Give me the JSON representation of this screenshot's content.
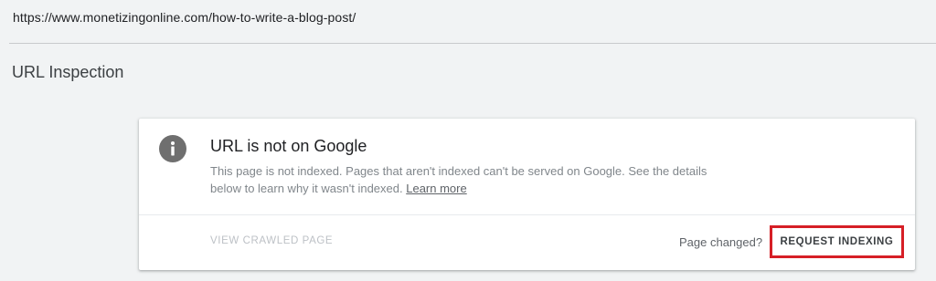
{
  "url_bar": {
    "url": "https://www.monetizingonline.com/how-to-write-a-blog-post/"
  },
  "section": {
    "title": "URL Inspection"
  },
  "card": {
    "icon": "info-icon",
    "title": "URL is not on Google",
    "description": "This page is not indexed. Pages that aren't indexed can't be served on Google. See the details below to learn why it wasn't indexed.",
    "learn_more": "Learn more",
    "view_crawled_label": "VIEW CRAWLED PAGE",
    "page_changed": "Page changed?",
    "request_indexing_label": "REQUEST INDEXING"
  },
  "colors": {
    "highlight_border": "#d61f26",
    "icon_bg": "#6f6f6f"
  }
}
